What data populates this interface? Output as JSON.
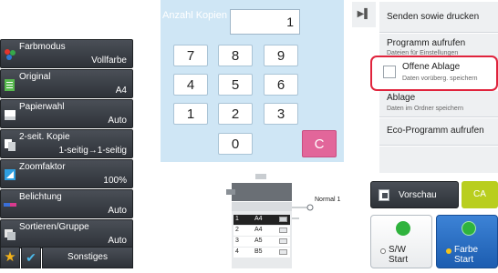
{
  "settings": [
    {
      "label": "Farbmodus",
      "value": "Vollfarbe",
      "icon": "color-mode-icon"
    },
    {
      "label": "Original",
      "value": "A4",
      "icon": "original-icon"
    },
    {
      "label": "Papierwahl",
      "value": "Auto",
      "icon": "paper-icon"
    },
    {
      "label": "2-seit. Kopie",
      "value": "1-seitig→1-seitig",
      "icon": "duplex-icon"
    },
    {
      "label": "Zoomfaktor",
      "value": "100%",
      "icon": "zoom-icon"
    },
    {
      "label": "Belichtung",
      "value": "Auto",
      "icon": "exposure-icon"
    },
    {
      "label": "Sortieren/Gruppe",
      "value": "Auto",
      "icon": "sort-icon"
    }
  ],
  "bottom_bar": {
    "other_label": "Sonstiges"
  },
  "keypad": {
    "title": "Anzahl Kopien",
    "count": "1",
    "keys": [
      "7",
      "8",
      "9",
      "4",
      "5",
      "6",
      "1",
      "2",
      "3",
      "0",
      "C"
    ]
  },
  "machine": {
    "output_label": "Normal 1",
    "trays": [
      {
        "num": "1",
        "size": "A4"
      },
      {
        "num": "2",
        "size": "A4"
      },
      {
        "num": "3",
        "size": "A5"
      },
      {
        "num": "4",
        "size": "B5"
      }
    ]
  },
  "right_menu": {
    "items": [
      {
        "title": "Senden sowie drucken",
        "sub": ""
      },
      {
        "title": "Programm aufrufen",
        "sub": "Dateien für Einstellungen"
      },
      {
        "title": "Offene Ablage",
        "sub": "Daten vorüberg. speichern"
      },
      {
        "title": "Ablage",
        "sub": "Daten im Ordner speichern"
      },
      {
        "title": "Eco-Programm aufrufen",
        "sub": ""
      }
    ]
  },
  "preview_label": "Vorschau",
  "ca_label": "CA",
  "start": {
    "bw_label": "S/W",
    "bw_sub": "Start",
    "color_label": "Farbe",
    "color_sub": "Start"
  },
  "colors": {
    "highlight": "#e0233c",
    "keypad_bg": "#cfe6f5",
    "clear_key": "#e2669a",
    "ca": "#b9ce1e",
    "start_color": "#1c5db0"
  }
}
